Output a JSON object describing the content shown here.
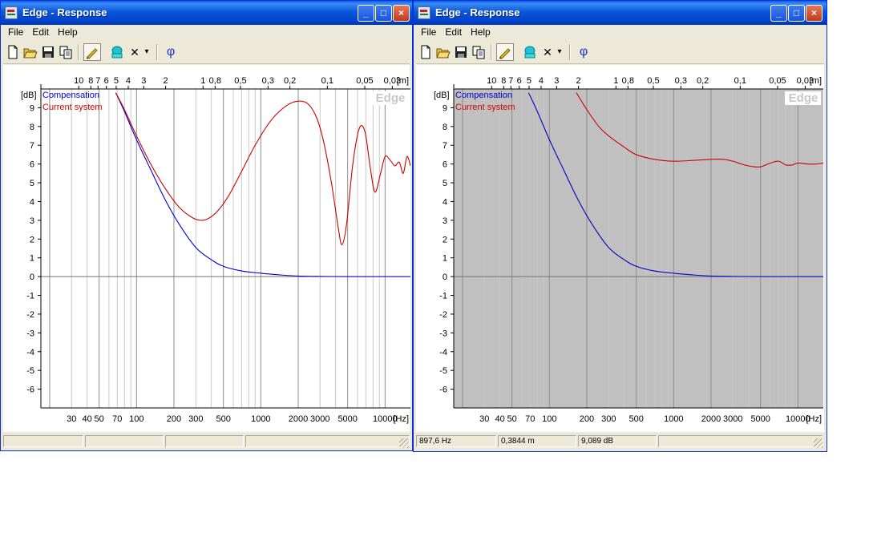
{
  "windows": [
    {
      "id": "w1",
      "title": "Edge - Response",
      "menu": [
        "File",
        "Edit",
        "Help"
      ],
      "status": [
        "",
        "",
        "",
        ""
      ],
      "title_buttons": {
        "minimize": "_",
        "maximize": "□",
        "close": "×"
      },
      "toolbar_icons": [
        "new-icon",
        "open-icon",
        "save-icon",
        "copy-icon",
        "draw-pen-icon",
        "speaker-icon",
        "delete-icon",
        "dropdown-arrow-icon",
        "phase-icon"
      ],
      "toolbar_labels": {
        "delete": "✕",
        "dropdown": "▾",
        "phase": "φ"
      }
    },
    {
      "id": "w2",
      "title": "Edge - Response",
      "menu": [
        "File",
        "Edit",
        "Help"
      ],
      "status": [
        "897,6 Hz",
        "0,3844 m",
        "9,089 dB",
        ""
      ],
      "title_buttons": {
        "minimize": "_",
        "maximize": "□",
        "close": "×"
      },
      "toolbar_icons": [
        "new-icon",
        "open-icon",
        "save-icon",
        "copy-icon",
        "draw-pen-icon",
        "speaker-icon",
        "delete-icon",
        "dropdown-arrow-icon",
        "phase-icon"
      ],
      "toolbar_labels": {
        "delete": "✕",
        "dropdown": "▾",
        "phase": "φ"
      }
    }
  ],
  "colors": {
    "compensation": "#0000cc",
    "current_system": "#cc0000",
    "grid_minor": "#c8c8c8",
    "grid_major": "#8c8c8c",
    "plot_bg_w2": "#c0c0c0",
    "watermark": "#c8c8c8"
  },
  "chart_data": [
    {
      "type": "line",
      "watermark": "Edge",
      "ylabel": "[dB]",
      "xlabel": "[Hz]",
      "top_axis_label": "[m]",
      "x_scale": "log",
      "xlim": [
        17,
        16000
      ],
      "ylim": [
        -7,
        10
      ],
      "y_ticks": [
        "9",
        "8",
        "7",
        "6",
        "5",
        "4",
        "3",
        "2",
        "1",
        "0",
        "-1",
        "-2",
        "-3",
        "-4",
        "-5",
        "-6"
      ],
      "x_tick_labels": [
        [
          "30",
          30
        ],
        [
          "40",
          40
        ],
        [
          "50",
          50
        ],
        [
          "70",
          70
        ],
        [
          "100",
          100
        ],
        [
          "200",
          200
        ],
        [
          "300",
          300
        ],
        [
          "500",
          500
        ],
        [
          "1000",
          1000
        ],
        [
          "2000",
          2000
        ],
        [
          "3000",
          3000
        ],
        [
          "5000",
          5000
        ],
        [
          "10000",
          10000
        ]
      ],
      "top_tick_labels": [
        [
          "10",
          34.3
        ],
        [
          "8",
          42.9
        ],
        [
          "7",
          49
        ],
        [
          "6",
          57.2
        ],
        [
          "5",
          68.6
        ],
        [
          "4",
          85.8
        ],
        [
          "3",
          114.3
        ],
        [
          "2",
          171.5
        ],
        [
          "1",
          343
        ],
        [
          "0,8",
          428.8
        ],
        [
          "0,5",
          686
        ],
        [
          "0,3",
          1143
        ],
        [
          "0,2",
          1715
        ],
        [
          "0,1",
          3430
        ],
        [
          "0,05",
          6860
        ],
        [
          "0,03",
          11433
        ]
      ],
      "series": [
        {
          "name": "Compensation",
          "color": "#0000cc",
          "x": [
            68,
            80,
            100,
            130,
            170,
            220,
            300,
            400,
            500,
            700,
            1000,
            1500,
            2000,
            3000,
            5000,
            10000,
            16000
          ],
          "y": [
            9.8,
            8.8,
            7.3,
            5.7,
            4.1,
            2.8,
            1.55,
            0.9,
            0.55,
            0.3,
            0.18,
            0.08,
            0.03,
            0.01,
            0.0,
            0.0,
            0.0
          ]
        },
        {
          "name": "Current system",
          "color": "#cc0000",
          "x": [
            68,
            80,
            100,
            130,
            170,
            220,
            280,
            330,
            380,
            450,
            550,
            700,
            900,
            1200,
            1600,
            2000,
            2400,
            2800,
            3200,
            3700,
            4200,
            4500,
            4900,
            5500,
            6200,
            6900,
            7600,
            8300,
            9200,
            10000,
            11000,
            12000,
            13000,
            14000,
            15000,
            16000
          ],
          "y": [
            9.8,
            8.9,
            7.5,
            6.0,
            4.7,
            3.7,
            3.15,
            3.0,
            3.1,
            3.5,
            4.3,
            5.6,
            7.0,
            8.3,
            9.1,
            9.35,
            9.2,
            8.5,
            7.2,
            5.0,
            2.6,
            1.7,
            2.8,
            6.0,
            7.9,
            7.7,
            5.8,
            4.5,
            5.5,
            6.4,
            6.2,
            5.9,
            6.1,
            5.5,
            6.4,
            5.9
          ]
        }
      ]
    },
    {
      "type": "line",
      "watermark": "Edge",
      "ylabel": "[dB]",
      "xlabel": "[Hz]",
      "top_axis_label": "[m]",
      "x_scale": "log",
      "xlim": [
        17,
        16000
      ],
      "ylim": [
        -7,
        10
      ],
      "y_ticks": [
        "9",
        "8",
        "7",
        "6",
        "5",
        "4",
        "3",
        "2",
        "1",
        "0",
        "-1",
        "-2",
        "-3",
        "-4",
        "-5",
        "-6"
      ],
      "x_tick_labels": [
        [
          "30",
          30
        ],
        [
          "40",
          40
        ],
        [
          "50",
          50
        ],
        [
          "70",
          70
        ],
        [
          "100",
          100
        ],
        [
          "200",
          200
        ],
        [
          "300",
          300
        ],
        [
          "500",
          500
        ],
        [
          "1000",
          1000
        ],
        [
          "2000",
          2000
        ],
        [
          "3000",
          3000
        ],
        [
          "5000",
          5000
        ],
        [
          "10000",
          10000
        ]
      ],
      "top_tick_labels": [
        [
          "10",
          34.3
        ],
        [
          "8",
          42.9
        ],
        [
          "7",
          49
        ],
        [
          "6",
          57.2
        ],
        [
          "5",
          68.6
        ],
        [
          "4",
          85.8
        ],
        [
          "3",
          114.3
        ],
        [
          "2",
          171.5
        ],
        [
          "1",
          343
        ],
        [
          "0,8",
          428.8
        ],
        [
          "0,5",
          686
        ],
        [
          "0,3",
          1143
        ],
        [
          "0,2",
          1715
        ],
        [
          "0,1",
          3430
        ],
        [
          "0,05",
          6860
        ],
        [
          "0,03",
          11433
        ]
      ],
      "series": [
        {
          "name": "Compensation",
          "color": "#0000cc",
          "x": [
            68,
            80,
            100,
            130,
            170,
            220,
            300,
            400,
            500,
            700,
            1000,
            1500,
            2000,
            3000,
            5000,
            10000,
            16000
          ],
          "y": [
            9.8,
            8.8,
            7.3,
            5.7,
            4.1,
            2.8,
            1.55,
            0.9,
            0.55,
            0.3,
            0.18,
            0.08,
            0.03,
            0.01,
            0.0,
            0.0,
            0.0
          ]
        },
        {
          "name": "Current system",
          "color": "#cc0000",
          "x": [
            165,
            200,
            250,
            300,
            400,
            500,
            700,
            1000,
            1500,
            2000,
            2500,
            3000,
            3500,
            4000,
            4500,
            5000,
            5500,
            6000,
            7000,
            8000,
            9000,
            10000,
            12000,
            14000,
            16000
          ],
          "y": [
            9.8,
            8.9,
            8.0,
            7.5,
            6.9,
            6.5,
            6.25,
            6.15,
            6.2,
            6.25,
            6.25,
            6.15,
            6.0,
            5.9,
            5.85,
            5.85,
            5.95,
            6.05,
            6.15,
            5.95,
            5.95,
            6.05,
            6.0,
            6.0,
            6.05
          ]
        }
      ]
    }
  ]
}
